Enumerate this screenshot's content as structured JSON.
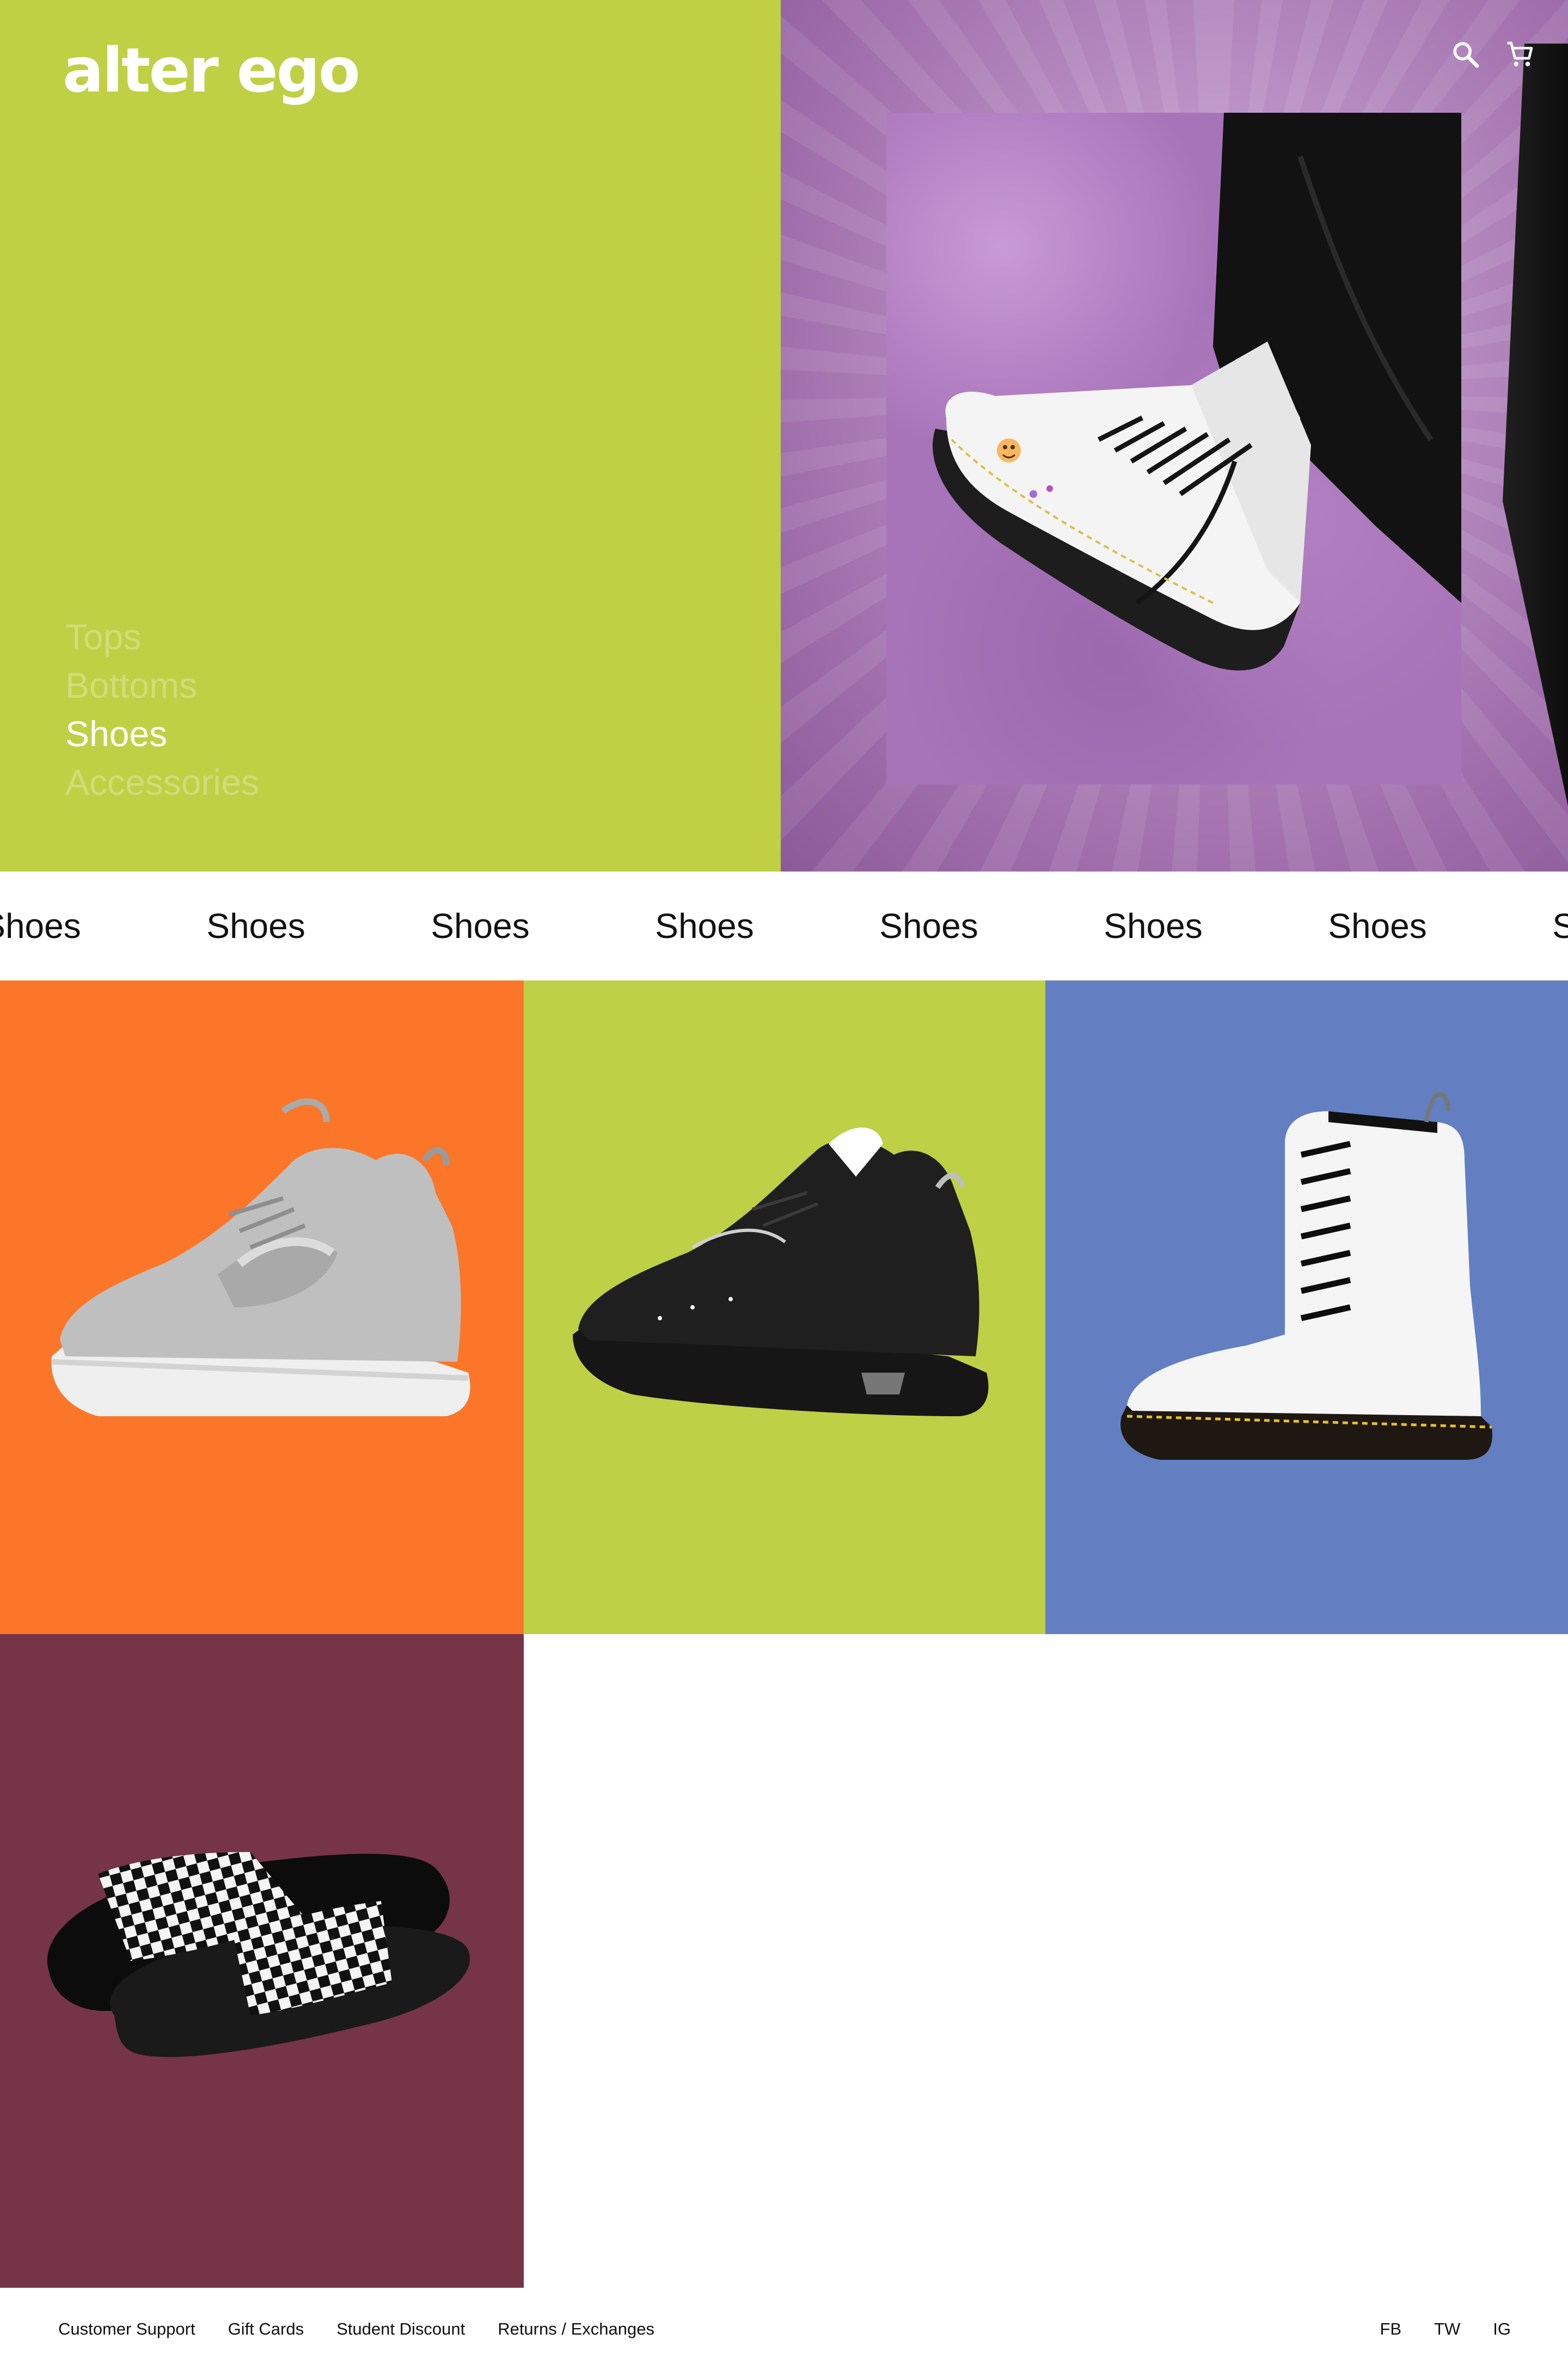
{
  "brand": {
    "logo": "alter ego"
  },
  "header": {
    "icons": [
      "search-icon",
      "cart-icon"
    ]
  },
  "categories": [
    {
      "label": "Tops",
      "active": false
    },
    {
      "label": "Bottoms",
      "active": false
    },
    {
      "label": "Shoes",
      "active": true
    },
    {
      "label": "Accessories",
      "active": false
    }
  ],
  "marquee": {
    "items": [
      "Shoes",
      "Shoes",
      "Shoes",
      "Shoes",
      "Shoes",
      "Shoes",
      "Shoes",
      "Shoes"
    ]
  },
  "products": [
    {
      "image": "silver-chunky-sneaker",
      "bg": "#fb7628"
    },
    {
      "image": "black-chunky-sneaker",
      "bg": "#bdd046"
    },
    {
      "image": "white-combat-boot",
      "bg": "#637fc2"
    },
    {
      "image": "checkerboard-slide-sandals",
      "bg": "#763448"
    }
  ],
  "colors": {
    "hero_left": "#bfd045",
    "hero_right": "#a874b9",
    "text_dark": "#111111",
    "white": "#ffffff"
  },
  "footer": {
    "links": [
      "Customer Support",
      "Gift Cards",
      "Student Discount",
      "Returns / Exchanges"
    ],
    "social": [
      "FB",
      "TW",
      "IG"
    ]
  }
}
